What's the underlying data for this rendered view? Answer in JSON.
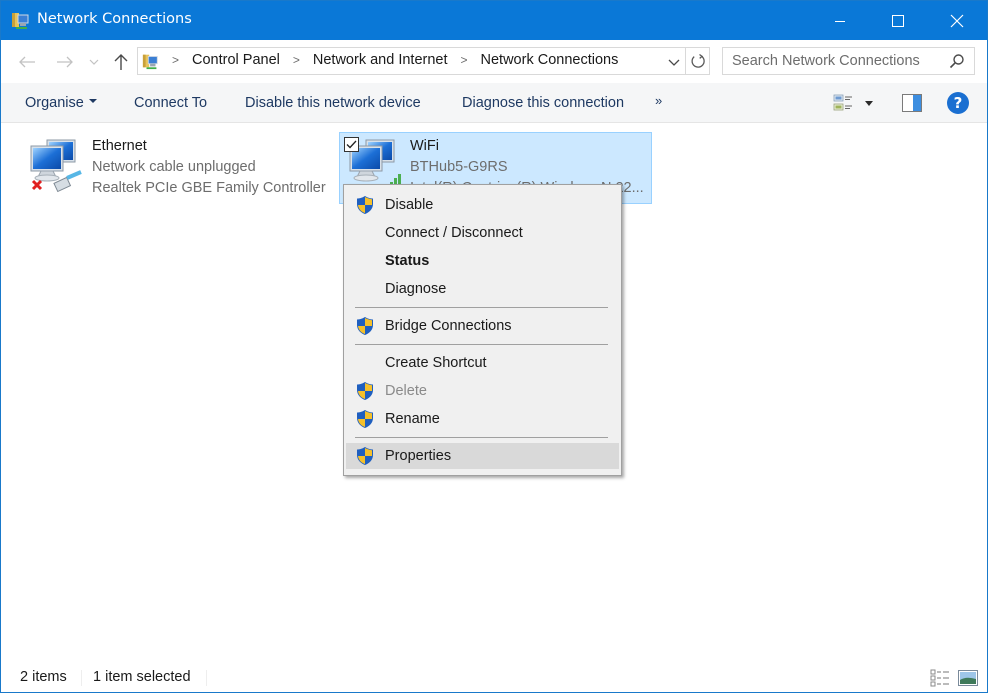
{
  "window": {
    "title": "Network Connections",
    "controls": {
      "minimize": "minimize",
      "maximize": "maximize",
      "close": "close"
    }
  },
  "nav": {
    "back_label": "Back",
    "forward_label": "Forward",
    "recent_label": "Recent locations",
    "up_label": "Up",
    "breadcrumb": [
      "Control Panel",
      "Network and Internet",
      "Network Connections"
    ],
    "search_placeholder": "Search Network Connections",
    "search_value": ""
  },
  "commandbar": {
    "organise": "Organise",
    "connect_to": "Connect To",
    "disable_device": "Disable this network device",
    "diagnose": "Diagnose this connection",
    "more": "»",
    "help": "?"
  },
  "items": [
    {
      "name": "Ethernet",
      "status": "Network cable unplugged",
      "adapter": "Realtek PCIe GBE Family Controller",
      "selected": false,
      "icon": "ethernet-disconnected-icon"
    },
    {
      "name": "WiFi",
      "status": "BTHub5-G9RS",
      "adapter": "Intel(R) Centrino(R) Wireless-N 22...",
      "selected": true,
      "icon": "wifi-adapter-icon"
    }
  ],
  "context_menu": {
    "items": [
      {
        "label": "Disable",
        "shield": true,
        "bold": false,
        "disabled": false
      },
      {
        "label": "Connect / Disconnect",
        "shield": false,
        "bold": false,
        "disabled": false
      },
      {
        "label": "Status",
        "shield": false,
        "bold": true,
        "disabled": false
      },
      {
        "label": "Diagnose",
        "shield": false,
        "bold": false,
        "disabled": false
      },
      {
        "label": "Bridge Connections",
        "shield": true,
        "bold": false,
        "disabled": false
      },
      {
        "label": "Create Shortcut",
        "shield": false,
        "bold": false,
        "disabled": false
      },
      {
        "label": "Delete",
        "shield": true,
        "bold": false,
        "disabled": true
      },
      {
        "label": "Rename",
        "shield": true,
        "bold": false,
        "disabled": false
      },
      {
        "label": "Properties",
        "shield": true,
        "bold": false,
        "disabled": false,
        "highlighted": true
      }
    ]
  },
  "statusbar": {
    "item_count": "2 items",
    "selected_count": "1 item selected"
  },
  "colors": {
    "titlebar": "#0a78d7",
    "selection_bg": "#cce8ff",
    "selection_border": "#99d1ff",
    "command_text": "#1e3962",
    "menu_bg": "#f0f0f0",
    "menu_hover": "#d9d9d9"
  }
}
